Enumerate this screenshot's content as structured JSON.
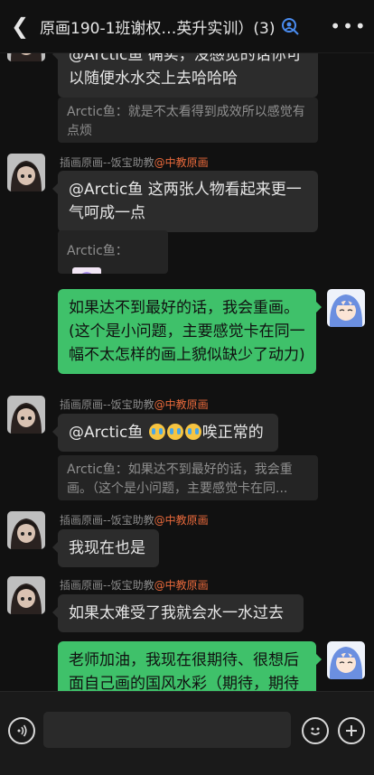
{
  "header": {
    "back_icon": "chevron-left-icon",
    "title": "原画190-1班谢权…英升实训）(3)",
    "group_icon": "group-members-icon",
    "more_icon": "more-dots-icon"
  },
  "messages": [
    {
      "kind": "text",
      "side": "left",
      "text": "@Arctic鱼 确实，没感觉的话你可以随便水水交上去哈哈哈"
    },
    {
      "kind": "quote",
      "text": "Arctic鱼：就是不太看得到成效所以感觉有点烦"
    },
    {
      "kind": "text",
      "side": "left",
      "sender": "插画原画--饭宝助教",
      "sender_tag": "@中教原画",
      "text": "@Arctic鱼 这两张人物看起来更一气呵成一点"
    },
    {
      "kind": "quote_image",
      "text": "Arctic鱼："
    },
    {
      "kind": "text",
      "side": "right",
      "text": "如果达不到最好的话，我会重画。(这个是小问题，主要感觉卡在同一幅不太怎样的画上貌似缺少了动力)"
    },
    {
      "kind": "text",
      "side": "left",
      "sender": "插画原画--饭宝助教",
      "sender_tag": "@中教原画",
      "text_before": "@Arctic鱼 ",
      "text_after": "唉正常的"
    },
    {
      "kind": "quote",
      "text": "Arctic鱼：如果达不到最好的话，我会重画。（这个是小问题，主要感觉卡在同..."
    },
    {
      "kind": "text",
      "side": "left",
      "sender": "插画原画--饭宝助教",
      "sender_tag": "@中教原画",
      "text": "我现在也是"
    },
    {
      "kind": "text",
      "side": "left",
      "sender": "插画原画--饭宝助教",
      "sender_tag": "@中教原画",
      "text": "如果太难受了我就会水一水过去"
    },
    {
      "kind": "text",
      "side": "right",
      "text": "老师加油，我现在很期待、很想后面自己画的国风水彩（期待，期待就对了）"
    }
  ],
  "composer": {
    "voice_icon": "voice-icon",
    "emoji_icon": "emoji-face-icon",
    "plus_icon": "plus-icon",
    "input_value": ""
  },
  "colors": {
    "background": "#111111",
    "bubble_dark": "#2c2c2c",
    "bubble_green": "#3fc16a",
    "sender_tag": "#e8693b"
  }
}
